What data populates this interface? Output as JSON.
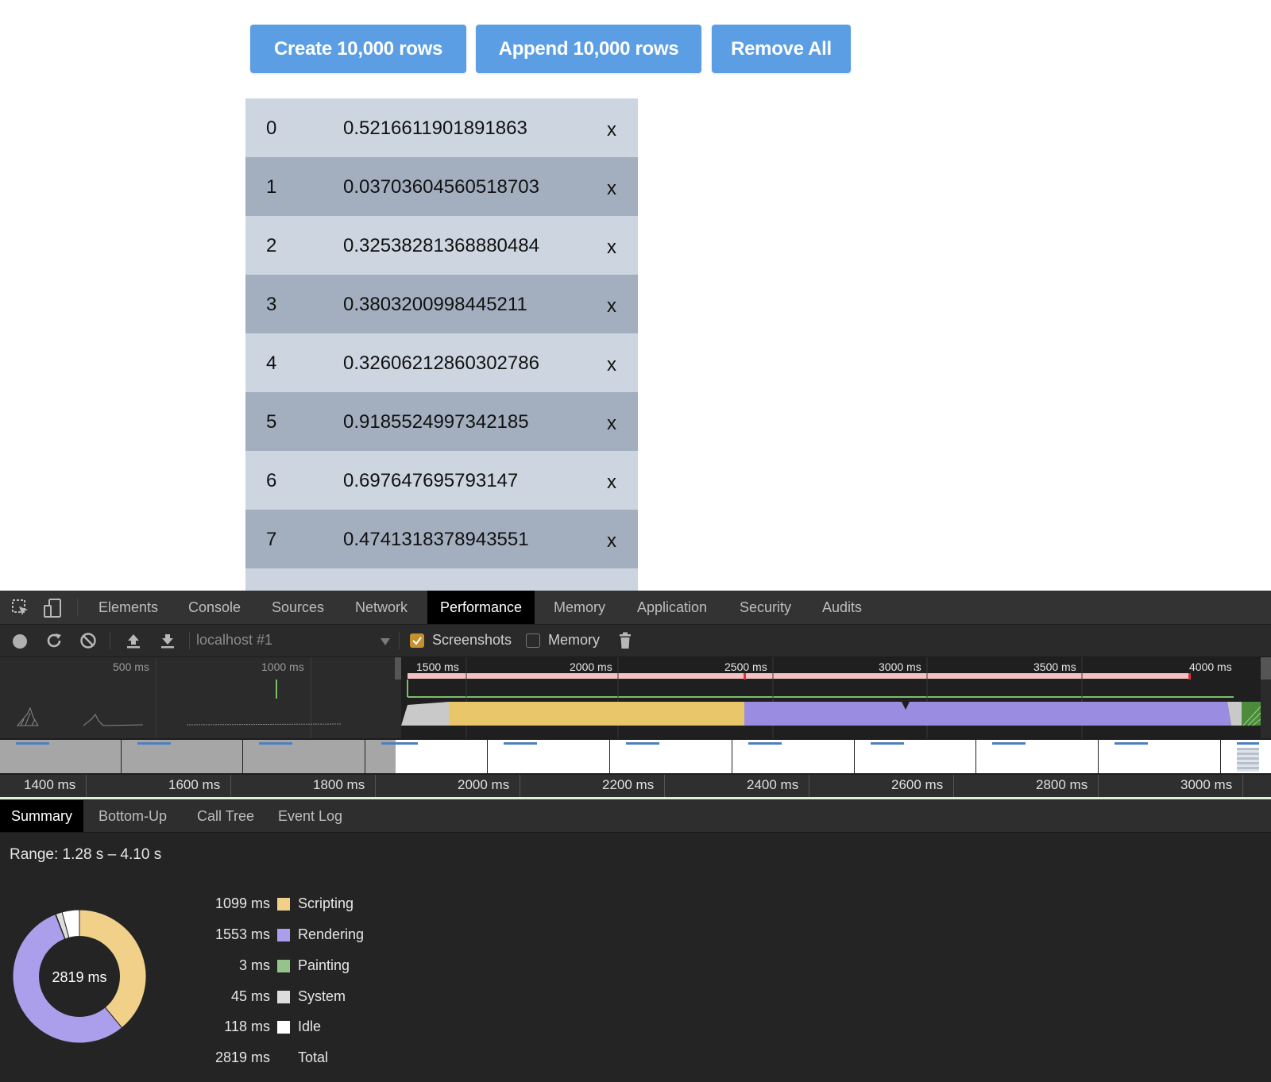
{
  "page": {
    "buttons": {
      "create": "Create 10,000 rows",
      "append": "Append 10,000 rows",
      "remove": "Remove All"
    },
    "rows": [
      {
        "id": "0",
        "value": "0.5216611901891863",
        "remove": "x"
      },
      {
        "id": "1",
        "value": "0.03703604560518703",
        "remove": "x"
      },
      {
        "id": "2",
        "value": "0.32538281368880484",
        "remove": "x"
      },
      {
        "id": "3",
        "value": "0.3803200998445211",
        "remove": "x"
      },
      {
        "id": "4",
        "value": "0.32606212860302786",
        "remove": "x"
      },
      {
        "id": "5",
        "value": "0.9185524997342185",
        "remove": "x"
      },
      {
        "id": "6",
        "value": "0.697647695793147",
        "remove": "x"
      },
      {
        "id": "7",
        "value": "0.4741318378943551",
        "remove": "x"
      }
    ]
  },
  "devtools": {
    "tabs": [
      "Elements",
      "Console",
      "Sources",
      "Network",
      "Performance",
      "Memory",
      "Application",
      "Security",
      "Audits"
    ],
    "active_tab": "Performance",
    "toolbar": {
      "profile_select": "localhost #1",
      "screenshots_label": "Screenshots",
      "screenshots_checked": true,
      "memory_label": "Memory",
      "memory_checked": false
    },
    "overview_ticks": [
      "500 ms",
      "1000 ms",
      "1500 ms",
      "2000 ms",
      "2500 ms",
      "3000 ms",
      "3500 ms",
      "4000 ms"
    ],
    "ruler_ticks": [
      "1400 ms",
      "1600 ms",
      "1800 ms",
      "2000 ms",
      "2200 ms",
      "2400 ms",
      "2600 ms",
      "2800 ms",
      "3000 ms"
    ],
    "bottom_tabs": [
      "Summary",
      "Bottom-Up",
      "Call Tree",
      "Event Log"
    ],
    "active_bottom_tab": "Summary",
    "summary": {
      "range": "Range: 1.28 s – 4.10 s",
      "total_center": "2819 ms",
      "items": [
        {
          "value": "1099 ms",
          "label": "Scripting",
          "color": "#f1d08a",
          "ms": 1099
        },
        {
          "value": "1553 ms",
          "label": "Rendering",
          "color": "#ab9eea",
          "ms": 1553
        },
        {
          "value": "3 ms",
          "label": "Painting",
          "color": "#95c48a",
          "ms": 3
        },
        {
          "value": "45 ms",
          "label": "System",
          "color": "#dddddd",
          "ms": 45
        },
        {
          "value": "118 ms",
          "label": "Idle",
          "color": "#ffffff",
          "ms": 118
        }
      ],
      "total": {
        "value": "2819 ms",
        "label": "Total"
      }
    }
  }
}
